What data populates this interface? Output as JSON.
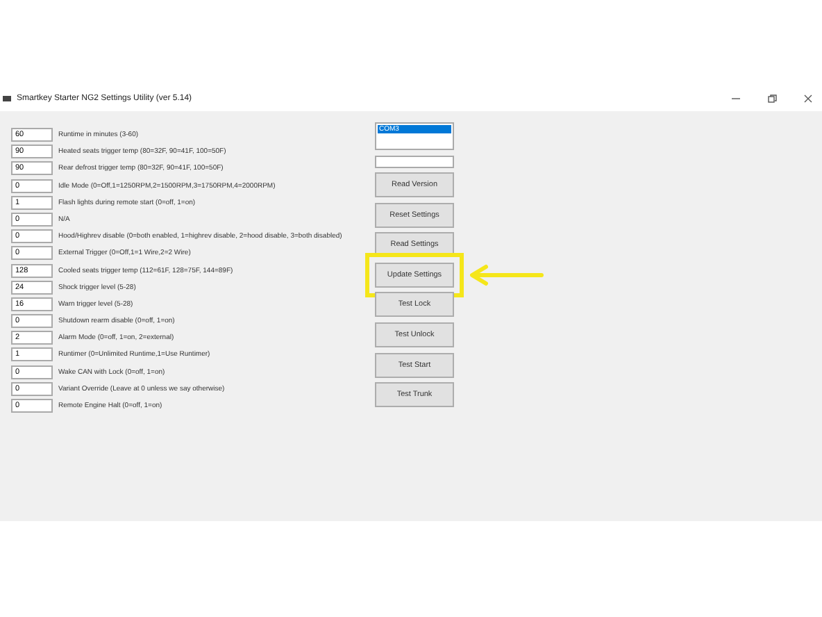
{
  "window": {
    "title": "Smartkey Starter NG2 Settings Utility (ver 5.14)"
  },
  "settings": [
    {
      "value": "60",
      "label": "Runtime in minutes (3-60)"
    },
    {
      "value": "90",
      "label": "Heated seats trigger temp (80=32F, 90=41F, 100=50F)"
    },
    {
      "value": "90",
      "label": "Rear defrost trigger temp (80=32F, 90=41F, 100=50F)"
    },
    {
      "value": "0",
      "label": "Idle Mode (0=Off,1=1250RPM,2=1500RPM,3=1750RPM,4=2000RPM)"
    },
    {
      "value": "1",
      "label": "Flash lights during remote start (0=off, 1=on)"
    },
    {
      "value": "0",
      "label": "N/A"
    },
    {
      "value": "0",
      "label": "Hood/Highrev disable (0=both enabled, 1=highrev disable, 2=hood disable, 3=both disabled)"
    },
    {
      "value": "0",
      "label": "External Trigger (0=Off,1=1 Wire,2=2 Wire)"
    },
    {
      "value": "128",
      "label": "Cooled seats trigger temp (112=61F, 128=75F, 144=89F)"
    },
    {
      "value": "24",
      "label": "Shock trigger level (5-28)"
    },
    {
      "value": "16",
      "label": "Warn trigger level (5-28)"
    },
    {
      "value": "0",
      "label": "Shutdown rearm disable (0=off, 1=on)"
    },
    {
      "value": "2",
      "label": "Alarm Mode (0=off, 1=on, 2=external)"
    },
    {
      "value": "1",
      "label": "Runtimer (0=Unlimited Runtime,1=Use Runtimer)"
    },
    {
      "value": "0",
      "label": "Wake CAN with Lock (0=off, 1=on)"
    },
    {
      "value": "0",
      "label": "Variant Override (Leave at 0 unless we say otherwise)"
    },
    {
      "value": "0",
      "label": "Remote Engine Halt (0=off, 1=on)"
    }
  ],
  "ports": [
    {
      "label": "COM3",
      "selected": true
    }
  ],
  "buttons": [
    {
      "label": "Read Version",
      "highlighted": false
    },
    {
      "label": "Reset Settings",
      "highlighted": false
    },
    {
      "label": "Read Settings",
      "highlighted": false
    },
    {
      "label": "Update Settings",
      "highlighted": true
    },
    {
      "label": "Test Lock",
      "highlighted": false
    },
    {
      "label": "Test Unlock",
      "highlighted": false
    },
    {
      "label": "Test Start",
      "highlighted": false
    },
    {
      "label": "Test Trunk",
      "highlighted": false
    }
  ]
}
